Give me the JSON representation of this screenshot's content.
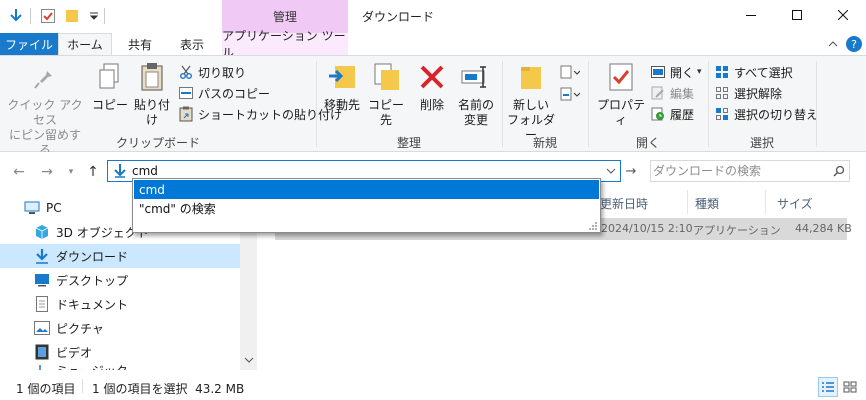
{
  "titlebar": {
    "context_group": "管理",
    "window_title": "ダウンロード"
  },
  "tabs": {
    "file": "ファイル",
    "home": "ホーム",
    "share": "共有",
    "view": "表示",
    "app_tools": "アプリケーション ツール"
  },
  "ribbon": {
    "clipboard": {
      "label": "クリップボード",
      "pin_quick_access": "クイック アクセス\nにピン留めする",
      "copy": "コピー",
      "paste": "貼り付け",
      "cut": "切り取り",
      "copy_path": "パスのコピー",
      "paste_shortcut": "ショートカットの貼り付け"
    },
    "organize": {
      "label": "整理",
      "move_to": "移動先",
      "copy_to": "コピー先",
      "delete": "削除",
      "rename": "名前の\n変更"
    },
    "new": {
      "label": "新規",
      "new_folder": "新しい\nフォルダー"
    },
    "open": {
      "label": "開く",
      "properties": "プロパティ",
      "open": "開く",
      "edit": "編集",
      "history": "履歴"
    },
    "select": {
      "label": "選択",
      "select_all": "すべて選択",
      "select_none": "選択解除",
      "invert": "選択の切り替え"
    }
  },
  "address": {
    "value": "cmd",
    "search_placeholder": "ダウンロードの検索"
  },
  "dropdown": {
    "items": [
      "cmd",
      "\"cmd\" の検索"
    ]
  },
  "navpane": {
    "items": [
      "PC",
      "3D オブジェクト",
      "ダウンロード",
      "デスクトップ",
      "ドキュメント",
      "ピクチャ",
      "ビデオ",
      "ミュージック"
    ]
  },
  "columns": {
    "date": "更新日時",
    "type": "種類",
    "size": "サイズ"
  },
  "file": {
    "date": "2024/10/15 2:10",
    "type": "アプリケーション",
    "size": "44,284 KB"
  },
  "status": {
    "count": "1 個の項目",
    "selected": "1 個の項目を選択  43.2 MB"
  },
  "colors": {
    "accent": "#1979ca",
    "context_tab": "#f1c9f5",
    "highlight": "#0078d7",
    "selected_row": "#d9d9d9"
  }
}
